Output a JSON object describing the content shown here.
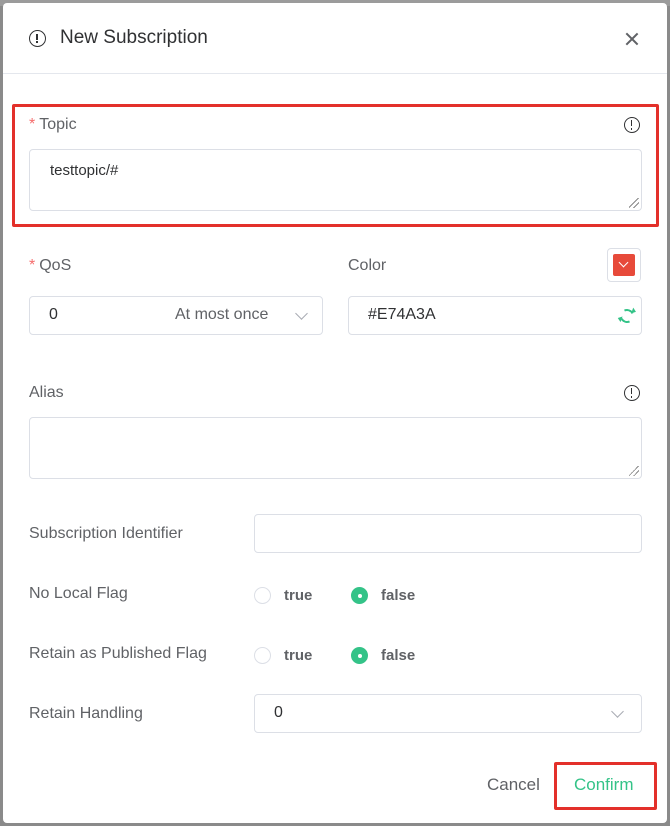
{
  "dialog": {
    "title": "New Subscription",
    "icon": "exclamation-circle-icon",
    "close_icon": "close-icon"
  },
  "topic": {
    "label": "Topic",
    "required_mark": "*",
    "value": "testtopic/#",
    "info_icon": "info-circle-icon"
  },
  "qos": {
    "label": "QoS",
    "required_mark": "*",
    "value": "0",
    "description": "At most once"
  },
  "color": {
    "label": "Color",
    "value": "#E74A3A",
    "swatch": "#E74A3A",
    "refresh_icon": "refresh-icon"
  },
  "alias": {
    "label": "Alias",
    "value": "",
    "info_icon": "info-circle-icon"
  },
  "subscription_identifier": {
    "label": "Subscription Identifier",
    "value": ""
  },
  "no_local_flag": {
    "label": "No Local Flag",
    "options": [
      "true",
      "false"
    ],
    "selected": "false"
  },
  "retain_as_published_flag": {
    "label": "Retain as Published Flag",
    "options": [
      "true",
      "false"
    ],
    "selected": "false"
  },
  "retain_handling": {
    "label": "Retain Handling",
    "value": "0"
  },
  "footer": {
    "cancel_label": "Cancel",
    "confirm_label": "Confirm"
  },
  "colors": {
    "accent": "#34C388",
    "required": "#F56C6C",
    "highlight": "#E3302A"
  }
}
